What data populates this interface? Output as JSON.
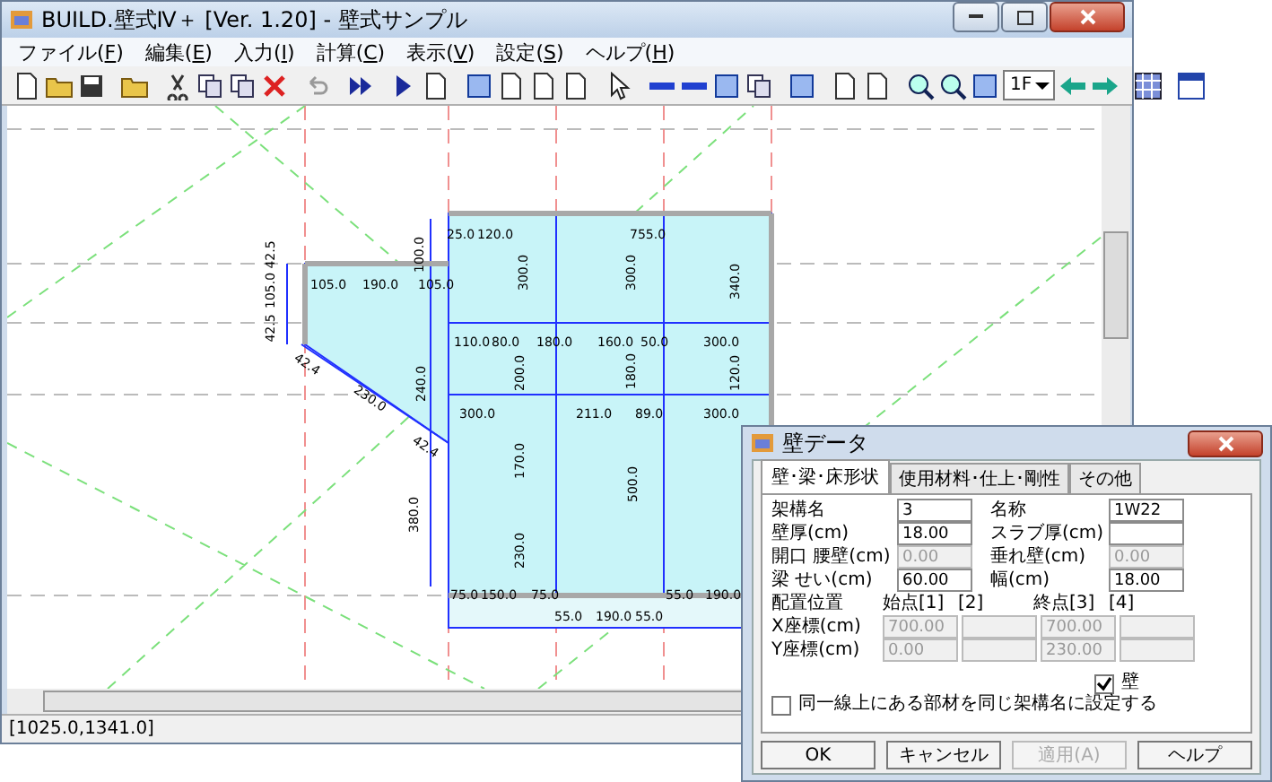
{
  "window": {
    "title": "BUILD.壁式Ⅳ＋ [Ver. 1.20] - 壁式サンプル"
  },
  "menu": [
    "ファイル(F)",
    "編集(E)",
    "入力(I)",
    "計算(C)",
    "表示(V)",
    "設定(S)",
    "ヘルプ(H)"
  ],
  "toolbar": {
    "floor_select": {
      "value": "1F"
    }
  },
  "plan": {
    "dimension_labels": [
      "25.0",
      "120.0",
      "755.0",
      "105.0",
      "190.0",
      "105.0",
      "110.0",
      "80.0",
      "180.0",
      "160.0",
      "50.0",
      "300.0",
      "300.0",
      "211.0",
      "89.0",
      "300.0",
      "75.0",
      "150.0",
      "75.0",
      "55.0",
      "190.0",
      "55.0",
      "190.0",
      "55.0"
    ],
    "vertical_labels": [
      "300.0",
      "300.0",
      "340.0",
      "200.0",
      "120.0",
      "240.0",
      "170.0",
      "500.0",
      "380.0",
      "230.0",
      "42.5",
      "105.0",
      "42.5",
      "100.0",
      "180.0"
    ],
    "slanted_labels": [
      "42.4",
      "230.0",
      "42.4"
    ]
  },
  "status_bar": {
    "coordinates": "[1025.0,1341.0]"
  },
  "dialog": {
    "title": "壁データ",
    "tabs": [
      {
        "label": "壁･梁･床形状",
        "selected": true
      },
      {
        "label": "使用材料･仕上･剛性",
        "selected": false
      },
      {
        "label": "その他",
        "selected": false
      }
    ],
    "rows": [
      {
        "label": "架構名",
        "value": "3",
        "disabled": false,
        "label2": "名称",
        "value2": "1W22",
        "disabled2": false
      },
      {
        "label": "壁厚(cm)",
        "value": "18.00",
        "disabled": false,
        "label2": "スラブ厚(cm)",
        "disabled2": false
      },
      {
        "label": "開口  腰壁(cm)",
        "value": "0.00",
        "disabled": true,
        "label2": "垂れ壁(cm)",
        "value2": "0.00",
        "disabled2": true
      },
      {
        "label": "梁  せい(cm)",
        "value": "60.00",
        "disabled": false,
        "label2": "幅(cm)",
        "value2": "18.00",
        "disabled2": false
      }
    ],
    "position": {
      "heading": "配置位置",
      "columns": [
        "始点[1]",
        "[2]",
        "終点[3]",
        "[4]"
      ],
      "rows": [
        {
          "label": "X座標(cm)",
          "start": "700.00",
          "end": "700.00"
        },
        {
          "label": "Y座標(cm)",
          "start": "0.00",
          "end": "230.00"
        }
      ]
    },
    "wall_checkbox": {
      "label": "壁",
      "checked": true
    },
    "same_line_checkbox": {
      "label": "同一線上にある部材を同じ架構名に設定する",
      "checked": false
    },
    "buttons": [
      {
        "label": "OK",
        "disabled": false
      },
      {
        "label": "キャンセル",
        "disabled": false
      },
      {
        "label": "適用(A)",
        "disabled": true
      },
      {
        "label": "ヘルプ",
        "disabled": false
      }
    ]
  }
}
